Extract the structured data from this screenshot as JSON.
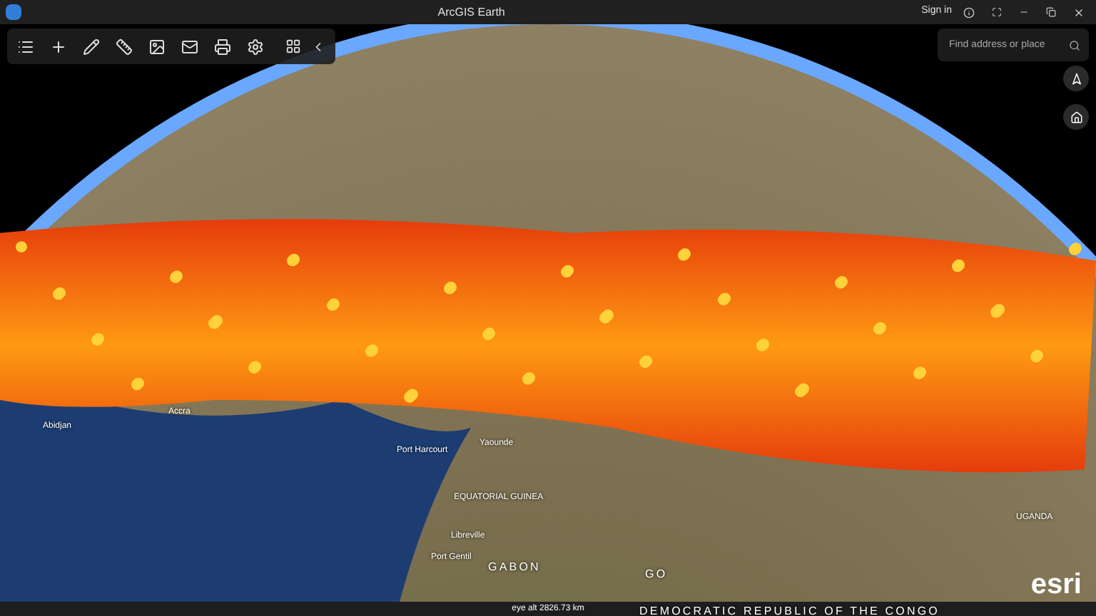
{
  "window": {
    "title": "ArcGIS Earth",
    "sign_in": "Sign in"
  },
  "search": {
    "placeholder": "Find address or place"
  },
  "map_labels": [
    {
      "kind": "city",
      "text": "Abidjan"
    },
    {
      "kind": "city",
      "text": "Accra"
    },
    {
      "kind": "city",
      "text": "Port Harcourt"
    },
    {
      "kind": "city",
      "text": "Yaounde"
    },
    {
      "kind": "region",
      "text": "EQUATORIAL GUINEA"
    },
    {
      "kind": "city",
      "text": "Libreville"
    },
    {
      "kind": "city",
      "text": "Port Gentil"
    },
    {
      "kind": "country",
      "text": "GABON"
    },
    {
      "kind": "country",
      "text": "GO"
    },
    {
      "kind": "country",
      "text": "DEMOCRATIC REPUBLIC OF THE CONGO"
    },
    {
      "kind": "region",
      "text": "UGANDA"
    }
  ],
  "status_bar": {
    "eye_alt": "eye alt 2826.73 km"
  },
  "logo": "esri"
}
